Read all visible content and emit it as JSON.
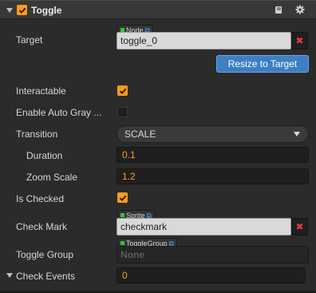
{
  "component": {
    "title": "Toggle",
    "enabled": true
  },
  "header_icons": [
    "book-icon",
    "gear-icon"
  ],
  "target": {
    "label": "Target",
    "type_tag": "Node",
    "value": "toggle_0",
    "clear_symbol": "✖"
  },
  "resize_button": "Resize to Target",
  "interactable": {
    "label": "Interactable",
    "checked": true
  },
  "enable_auto_gray": {
    "label": "Enable Auto Gray ...",
    "checked": false
  },
  "transition": {
    "label": "Transition",
    "value": "SCALE"
  },
  "duration": {
    "label": "Duration",
    "value": "0.1"
  },
  "zoom_scale": {
    "label": "Zoom Scale",
    "value": "1.2"
  },
  "is_checked": {
    "label": "Is Checked",
    "checked": true
  },
  "check_mark": {
    "label": "Check Mark",
    "type_tag": "Sprite",
    "value": "checkmark",
    "clear_symbol": "✖"
  },
  "toggle_group": {
    "label": "Toggle Group",
    "type_tag": "ToggleGroup",
    "value": "None"
  },
  "check_events": {
    "label": "Check Events",
    "value": "0"
  },
  "colors": {
    "accent_orange": "#ff9a1e",
    "button_blue": "#3c7fc4",
    "clear_red": "#e0393b",
    "tag_green": "#3cbf3c"
  }
}
